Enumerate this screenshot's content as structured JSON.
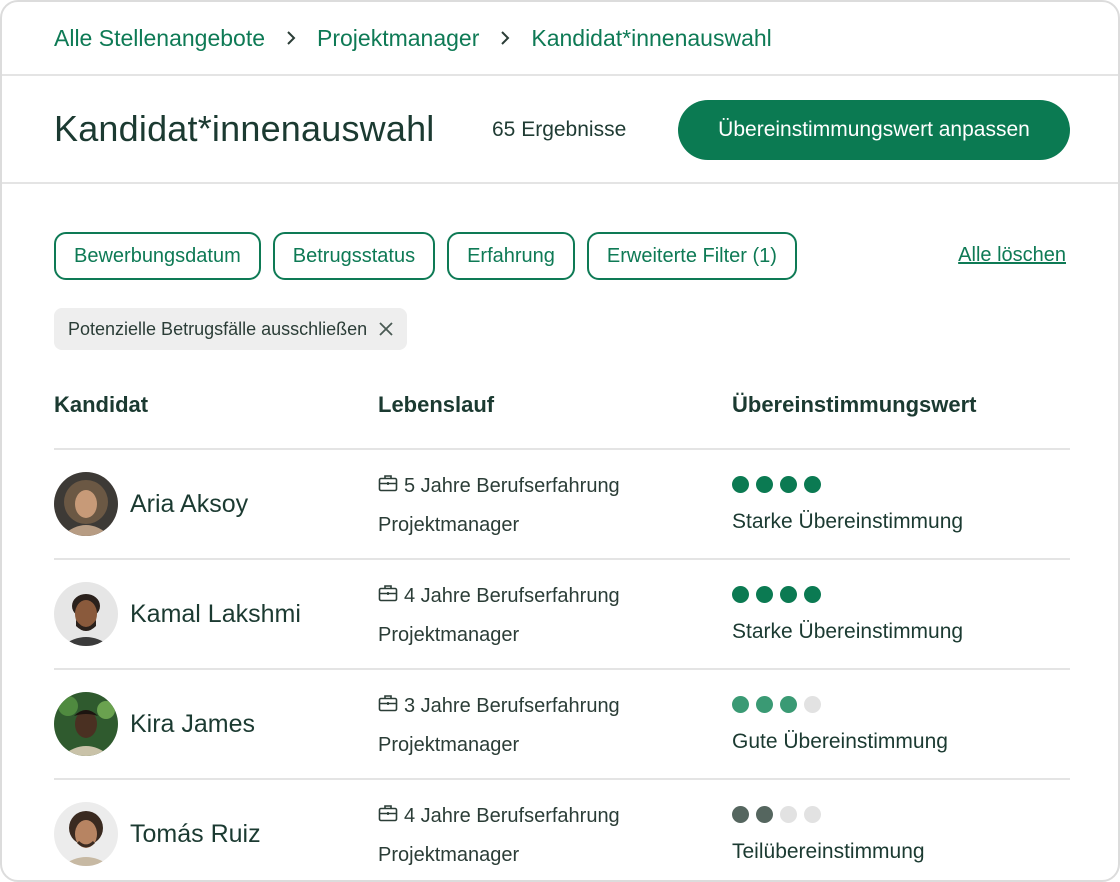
{
  "breadcrumb": [
    "Alle Stellenangebote",
    "Projektmanager",
    "Kandidat*innenauswahl"
  ],
  "header": {
    "title": "Kandidat*innenauswahl",
    "result_count": "65 Ergebnisse",
    "adjust_button": "Übereinstimmungswert anpassen"
  },
  "filters": {
    "chips": [
      "Bewerbungsdatum",
      "Betrugsstatus",
      "Erfahrung",
      "Erweiterte Filter (1)"
    ],
    "clear_all": "Alle löschen",
    "active_tag": "Potenzielle Betrugsfälle ausschließen"
  },
  "table": {
    "columns": [
      "Kandidat",
      "Lebenslauf",
      "Übereinstimmungswert"
    ],
    "rows": [
      {
        "name": "Aria Aksoy",
        "experience": "5 Jahre Berufserfahrung",
        "role": "Projektmanager",
        "match_label": "Starke Übereinstimmung",
        "match_score": 4,
        "match_max": 4,
        "dot_color": "#0b7a52"
      },
      {
        "name": "Kamal Lakshmi",
        "experience": "4 Jahre Berufserfahrung",
        "role": "Projektmanager",
        "match_label": "Starke Übereinstimmung",
        "match_score": 4,
        "match_max": 4,
        "dot_color": "#0b7a52"
      },
      {
        "name": "Kira James",
        "experience": "3 Jahre Berufserfahrung",
        "role": "Projektmanager",
        "match_label": "Gute Übereinstimmung",
        "match_score": 3,
        "match_max": 4,
        "dot_color": "#3a9a74"
      },
      {
        "name": "Tomás Ruiz",
        "experience": "4 Jahre Berufserfahrung",
        "role": "Projektmanager",
        "match_label": "Teilübereinstimmung",
        "match_score": 2,
        "match_max": 4,
        "dot_color": "#55665f"
      }
    ]
  },
  "icons": {
    "breadcrumb_separator": "chevron-right-icon",
    "experience": "briefcase-icon",
    "remove_tag": "close-icon"
  },
  "colors": {
    "accent": "#0b7a52",
    "empty_dot": "#e2e2e2",
    "tag_background": "#eeeeee"
  }
}
